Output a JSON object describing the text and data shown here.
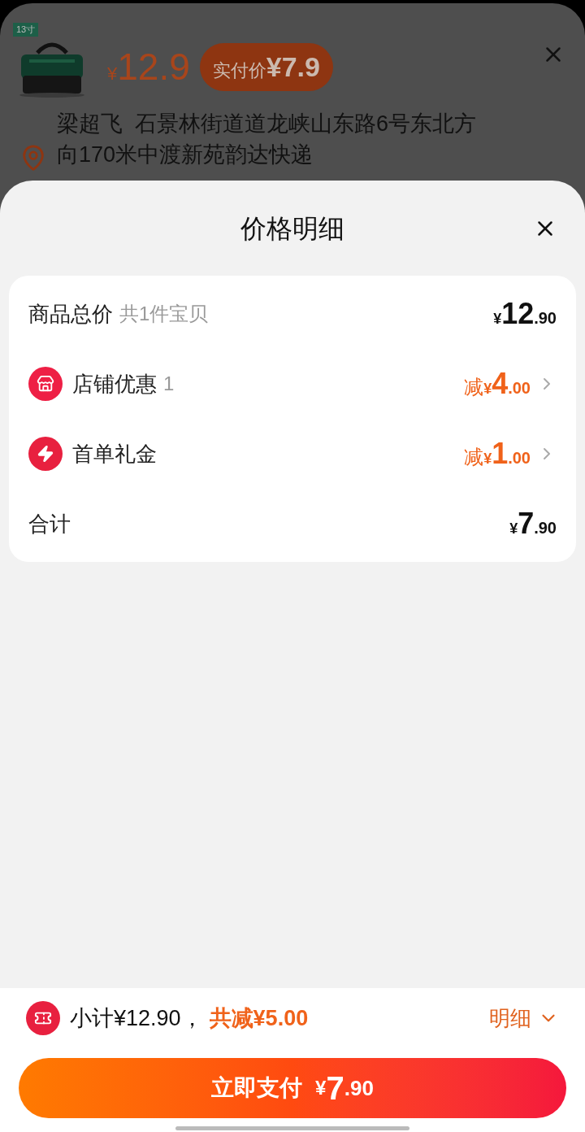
{
  "background_page": {
    "product_tag": "13寸",
    "price_currency": "¥",
    "price": "12.9",
    "actual_price_label": "实付价",
    "actual_price": "¥7.9",
    "address_lines": [
      "梁超飞  石景林街道道龙峡山东路6号东北方",
      "向170米中渡新苑韵达快递"
    ]
  },
  "sheet": {
    "title": "价格明细",
    "rows": [
      {
        "kind": "total",
        "label": "商品总价",
        "note": "共1件宝贝",
        "prefix": "",
        "currency": "¥",
        "integer": "12",
        "decimal": ".90"
      },
      {
        "kind": "shop",
        "label": "店铺优惠",
        "note": "1",
        "prefix": "减",
        "currency": "¥",
        "integer": "4",
        "decimal": ".00"
      },
      {
        "kind": "gift",
        "label": "首单礼金",
        "note": "",
        "prefix": "减",
        "currency": "¥",
        "integer": "1",
        "decimal": ".00"
      },
      {
        "kind": "total",
        "label": "合计",
        "note": "",
        "prefix": "",
        "currency": "¥",
        "integer": "7",
        "decimal": ".90"
      }
    ]
  },
  "footer": {
    "subtotal": "小计¥12.90，",
    "discount": "共减¥5.00",
    "details_toggle": "明细",
    "pay_button": {
      "label": "立即支付",
      "currency": "¥",
      "integer": "7",
      "decimal": ".90"
    }
  }
}
